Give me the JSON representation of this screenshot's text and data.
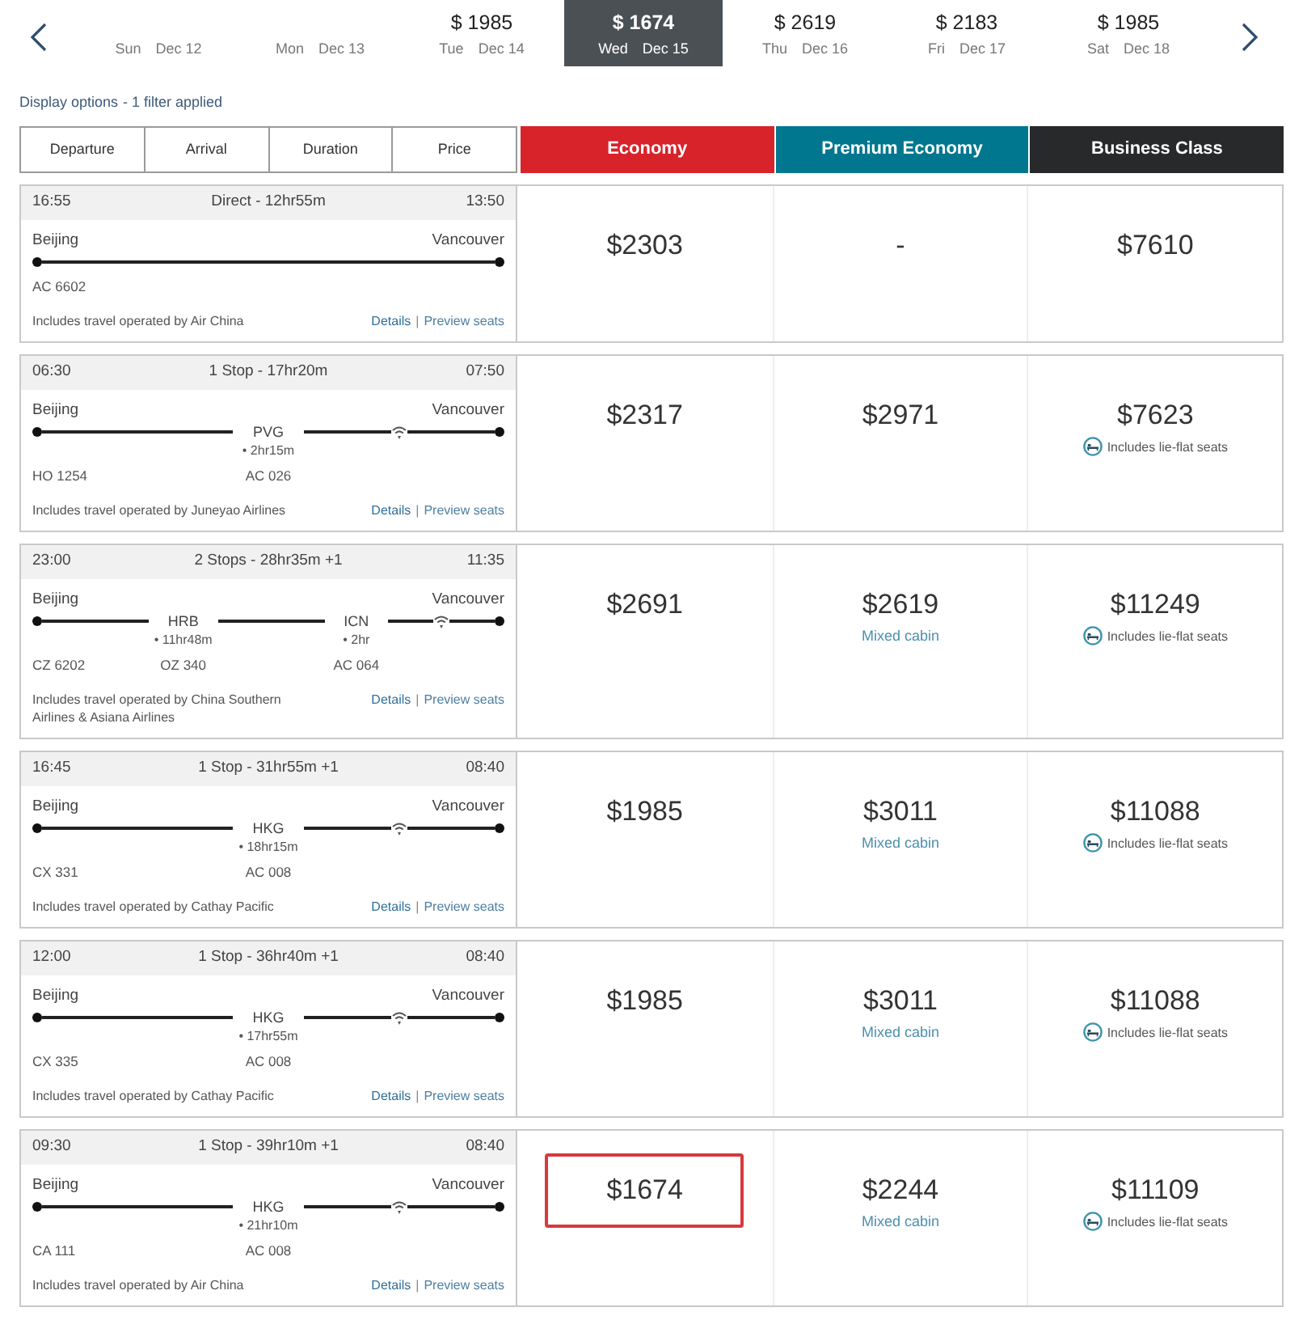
{
  "date_nav": {
    "dates": [
      {
        "day": "Sun",
        "date": "Dec 12",
        "selected": false
      },
      {
        "day": "Mon",
        "date": "Dec 13",
        "selected": false
      },
      {
        "price": "$ 1985",
        "day": "Tue",
        "date": "Dec 14",
        "selected": false
      },
      {
        "price": "$ 1674",
        "day": "Wed",
        "date": "Dec 15",
        "selected": true
      },
      {
        "price": "$ 2619",
        "day": "Thu",
        "date": "Dec 16",
        "selected": false
      },
      {
        "price": "$ 2183",
        "day": "Fri",
        "date": "Dec 17",
        "selected": false
      },
      {
        "price": "$ 1985",
        "day": "Sat",
        "date": "Dec 18",
        "selected": false
      }
    ]
  },
  "display_options": {
    "link": "Display options",
    "status": "- 1 filter applied"
  },
  "sort_options": [
    "Departure",
    "Arrival",
    "Duration",
    "Price"
  ],
  "cabins": [
    {
      "label": "Economy",
      "color": "#d8232a"
    },
    {
      "label": "Premium Economy",
      "color": "#00778f"
    },
    {
      "label": "Business Class",
      "color": "#28292b"
    }
  ],
  "flights": [
    {
      "departure": "16:55",
      "summary": "Direct - 12hr55m",
      "arrival": "13:50",
      "origin": "Beijing",
      "destination": "Vancouver",
      "segments": [
        {
          "flight": "AC 6602",
          "wifi": false
        }
      ],
      "operated_by": "Includes travel operated by Air China",
      "details_link": "Details",
      "separator": "|",
      "seats_link": "Preview seats",
      "fares": [
        {
          "price": "$2303",
          "highlighted": false
        },
        {
          "price": "-",
          "highlighted": false
        },
        {
          "price": "$7610",
          "highlighted": false
        }
      ]
    },
    {
      "departure": "06:30",
      "summary": "1 Stop - 17hr20m",
      "arrival": "07:50",
      "origin": "Beijing",
      "destination": "Vancouver",
      "segments": [
        {
          "flight": "HO 1254",
          "wifi": false
        },
        {
          "stop": "PVG",
          "layover": "• 2hr15m",
          "flight": "AC 026",
          "wifi": true
        }
      ],
      "operated_by": "Includes travel operated by Juneyao Airlines",
      "details_link": "Details",
      "separator": "|",
      "seats_link": "Preview seats",
      "fares": [
        {
          "price": "$2317",
          "highlighted": false
        },
        {
          "price": "$2971",
          "highlighted": false
        },
        {
          "price": "$7623",
          "highlighted": false,
          "note": {
            "kind": "lie_flat",
            "text": "Includes lie-flat seats"
          }
        }
      ]
    },
    {
      "departure": "23:00",
      "summary": "2 Stops - 28hr35m +1",
      "arrival": "11:35",
      "origin": "Beijing",
      "destination": "Vancouver",
      "segments": [
        {
          "flight": "CZ 6202",
          "wifi": false
        },
        {
          "stop": "HRB",
          "layover": "• 11hr48m",
          "flight": "OZ 340",
          "wifi": false
        },
        {
          "stop": "ICN",
          "layover": "• 2hr",
          "flight": "AC 064",
          "wifi": true
        }
      ],
      "operated_by": "Includes travel operated by China Southern Airlines & Asiana Airlines",
      "details_link": "Details",
      "separator": "|",
      "seats_link": "Preview seats",
      "fares": [
        {
          "price": "$2691",
          "highlighted": false
        },
        {
          "price": "$2619",
          "highlighted": false,
          "note": {
            "kind": "mixed_cabin",
            "text": "Mixed cabin"
          }
        },
        {
          "price": "$11249",
          "highlighted": false,
          "note": {
            "kind": "lie_flat",
            "text": "Includes lie-flat seats"
          }
        }
      ]
    },
    {
      "departure": "16:45",
      "summary": "1 Stop - 31hr55m +1",
      "arrival": "08:40",
      "origin": "Beijing",
      "destination": "Vancouver",
      "segments": [
        {
          "flight": "CX 331",
          "wifi": false
        },
        {
          "stop": "HKG",
          "layover": "• 18hr15m",
          "flight": "AC 008",
          "wifi": true
        }
      ],
      "operated_by": "Includes travel operated by Cathay Pacific",
      "details_link": "Details",
      "separator": "|",
      "seats_link": "Preview seats",
      "fares": [
        {
          "price": "$1985",
          "highlighted": false
        },
        {
          "price": "$3011",
          "highlighted": false,
          "note": {
            "kind": "mixed_cabin",
            "text": "Mixed cabin"
          }
        },
        {
          "price": "$11088",
          "highlighted": false,
          "note": {
            "kind": "lie_flat",
            "text": "Includes lie-flat seats"
          }
        }
      ]
    },
    {
      "departure": "12:00",
      "summary": "1 Stop - 36hr40m +1",
      "arrival": "08:40",
      "origin": "Beijing",
      "destination": "Vancouver",
      "segments": [
        {
          "flight": "CX 335",
          "wifi": false
        },
        {
          "stop": "HKG",
          "layover": "• 17hr55m",
          "flight": "AC 008",
          "wifi": true
        }
      ],
      "operated_by": "Includes travel operated by Cathay Pacific",
      "details_link": "Details",
      "separator": "|",
      "seats_link": "Preview seats",
      "fares": [
        {
          "price": "$1985",
          "highlighted": false
        },
        {
          "price": "$3011",
          "highlighted": false,
          "note": {
            "kind": "mixed_cabin",
            "text": "Mixed cabin"
          }
        },
        {
          "price": "$11088",
          "highlighted": false,
          "note": {
            "kind": "lie_flat",
            "text": "Includes lie-flat seats"
          }
        }
      ]
    },
    {
      "departure": "09:30",
      "summary": "1 Stop - 39hr10m +1",
      "arrival": "08:40",
      "origin": "Beijing",
      "destination": "Vancouver",
      "segments": [
        {
          "flight": "CA 111",
          "wifi": false
        },
        {
          "stop": "HKG",
          "layover": "• 21hr10m",
          "flight": "AC 008",
          "wifi": true
        }
      ],
      "operated_by": "Includes travel operated by Air China",
      "details_link": "Details",
      "separator": "|",
      "seats_link": "Preview seats",
      "fares": [
        {
          "price": "$1674",
          "highlighted": true
        },
        {
          "price": "$2244",
          "highlighted": false,
          "note": {
            "kind": "mixed_cabin",
            "text": "Mixed cabin"
          }
        },
        {
          "price": "$11109",
          "highlighted": false,
          "note": {
            "kind": "lie_flat",
            "text": "Includes lie-flat seats"
          }
        }
      ]
    }
  ]
}
